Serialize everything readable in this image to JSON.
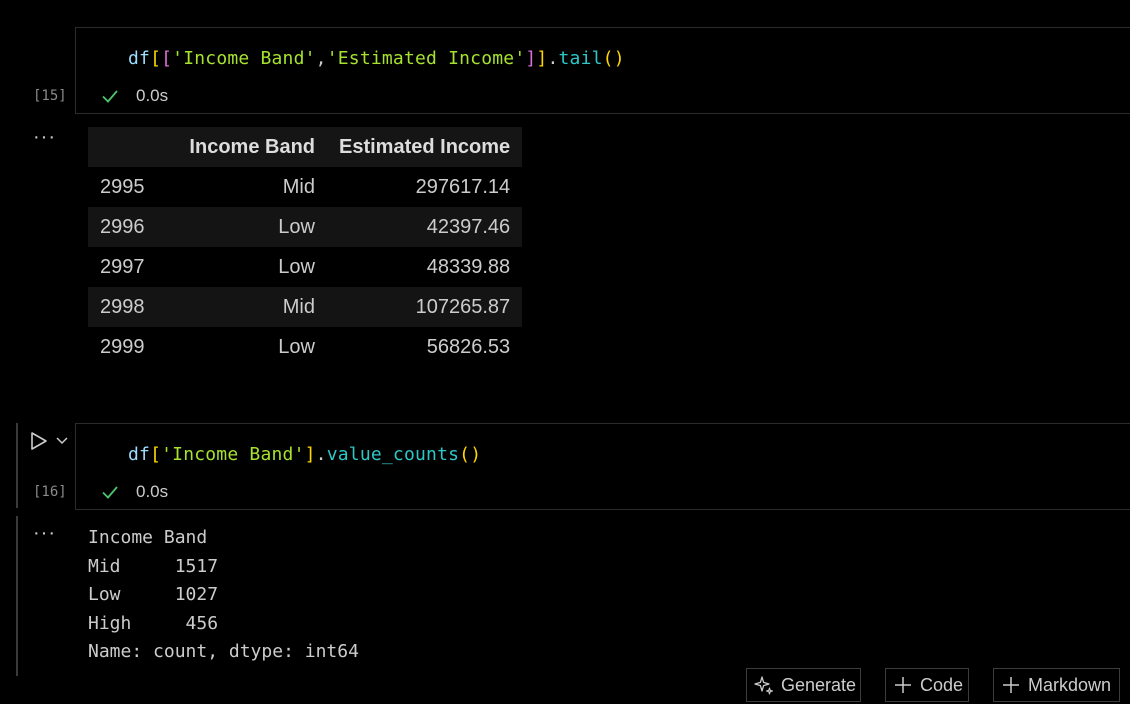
{
  "cells": [
    {
      "exec_count": "[15]",
      "code_tokens": [
        {
          "text": "df",
          "cls": "tk-id"
        },
        {
          "text": "[",
          "cls": "tk-br1"
        },
        {
          "text": "[",
          "cls": "tk-br2"
        },
        {
          "text": "'Income Band'",
          "cls": "tk-str"
        },
        {
          "text": ",",
          "cls": "tk-punc"
        },
        {
          "text": "'Estimated Income'",
          "cls": "tk-str"
        },
        {
          "text": "]",
          "cls": "tk-br2"
        },
        {
          "text": "]",
          "cls": "tk-br1"
        },
        {
          "text": ".",
          "cls": "tk-punc"
        },
        {
          "text": "tail",
          "cls": "tk-fn"
        },
        {
          "text": "()",
          "cls": "tk-br1"
        }
      ],
      "exec_time": "0.0s",
      "output": {
        "columns": [
          "",
          "Income Band",
          "Estimated Income"
        ],
        "rows": [
          [
            "2995",
            "Mid",
            "297617.14"
          ],
          [
            "2996",
            "Low",
            "42397.46"
          ],
          [
            "2997",
            "Low",
            "48339.88"
          ],
          [
            "2998",
            "Mid",
            "107265.87"
          ],
          [
            "2999",
            "Low",
            "56826.53"
          ]
        ]
      }
    },
    {
      "exec_count": "[16]",
      "code_tokens": [
        {
          "text": "df",
          "cls": "tk-id"
        },
        {
          "text": "[",
          "cls": "tk-br1"
        },
        {
          "text": "'Income Band'",
          "cls": "tk-str"
        },
        {
          "text": "]",
          "cls": "tk-br1"
        },
        {
          "text": ".",
          "cls": "tk-punc"
        },
        {
          "text": "value_counts",
          "cls": "tk-fn"
        },
        {
          "text": "()",
          "cls": "tk-br1"
        }
      ],
      "exec_time": "0.0s",
      "output_text": "Income Band\nMid     1517\nLow     1027\nHigh     456\nName: count, dtype: int64"
    }
  ],
  "output_menu_glyph": "···",
  "toolbar": {
    "generate_label": "Generate",
    "code_label": "Code",
    "markdown_label": "Markdown"
  },
  "icons": {
    "check": "check-icon",
    "run": "play-icon",
    "chevron": "chevron-down-icon",
    "sparkle": "sparkle-icon",
    "plus": "plus-icon"
  },
  "colors": {
    "success_check": "#4ec36b",
    "string": "#a6e22e",
    "function": "#2ec7c7",
    "bracket_outer": "#ffd700",
    "bracket_inner": "#da70d6"
  }
}
